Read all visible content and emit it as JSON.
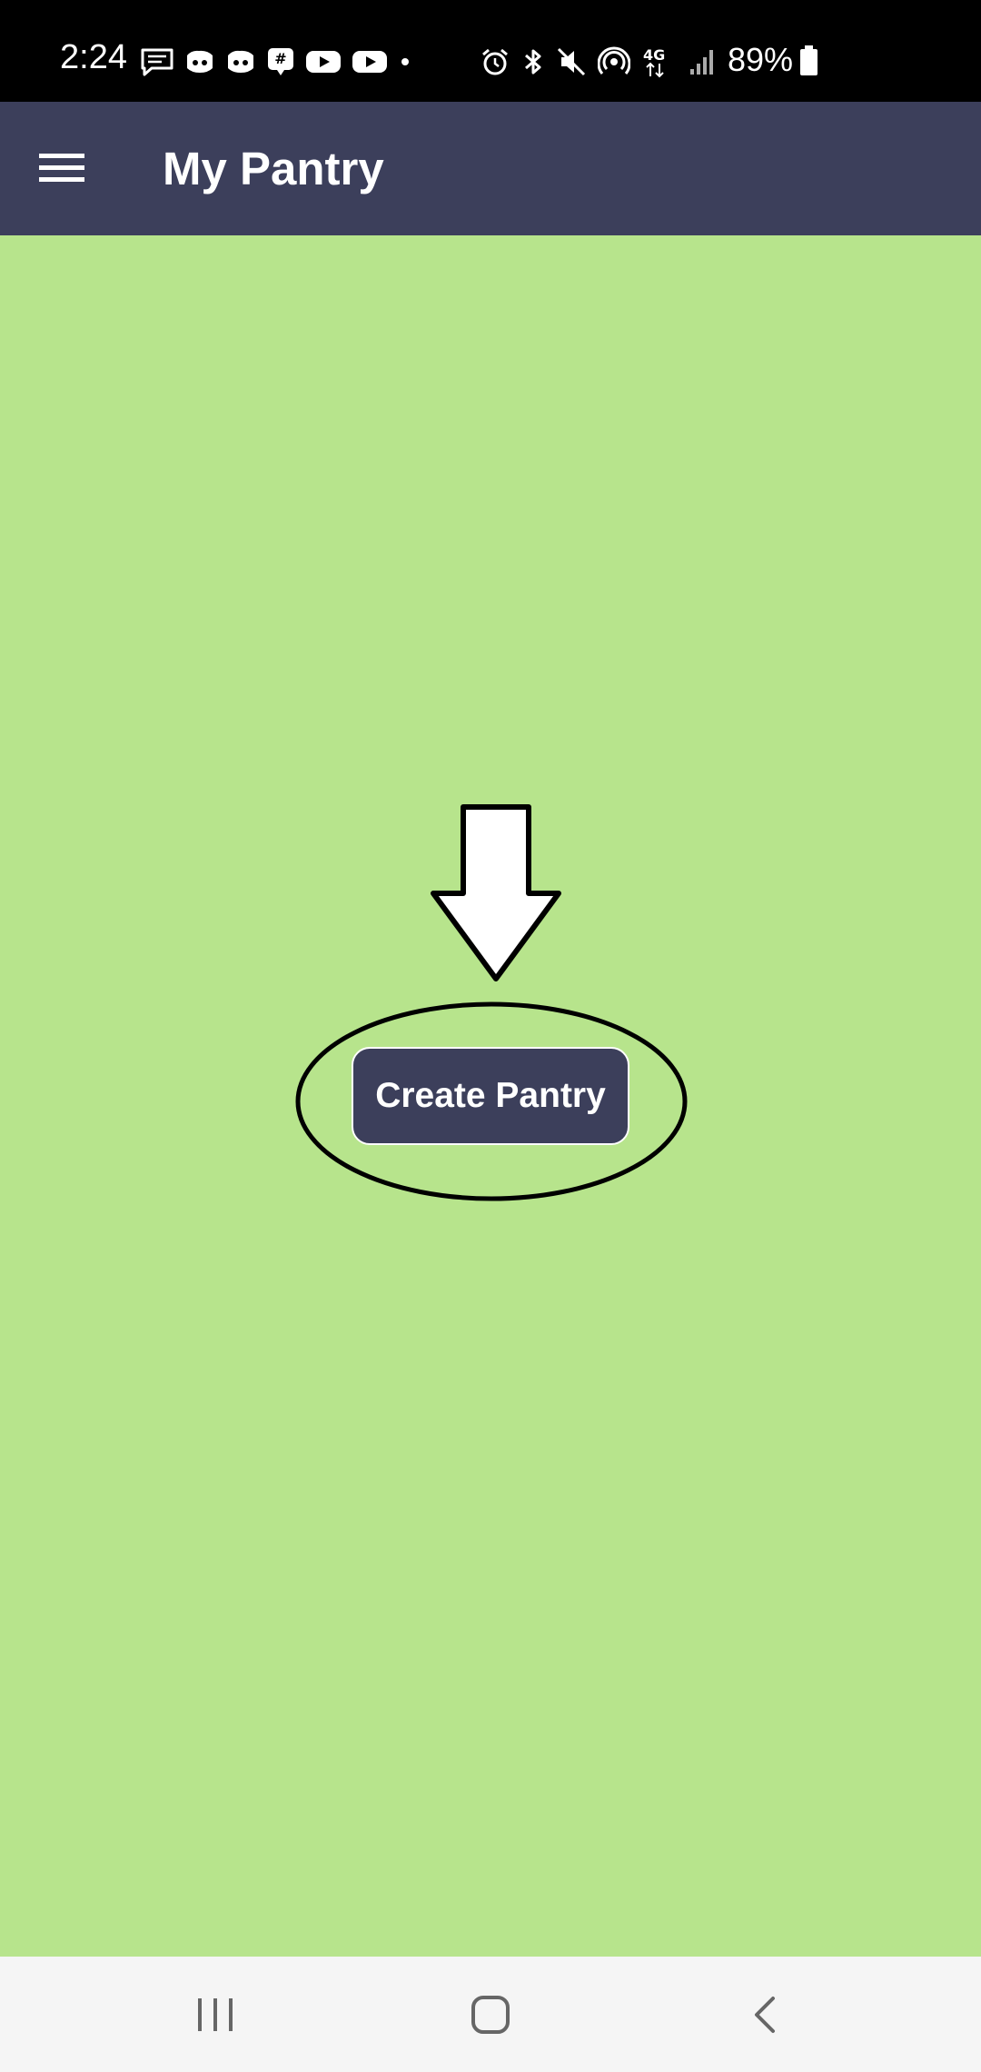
{
  "status_bar": {
    "time": "2:24",
    "battery_percent": "89%",
    "notification_icons": [
      "message-icon",
      "discord-icon",
      "discord-icon",
      "groupme-icon",
      "youtube-icon",
      "youtube-icon",
      "more-notifications-dot-icon"
    ],
    "system_icons": [
      "alarm-icon",
      "bluetooth-icon",
      "mute-icon",
      "hotspot-icon",
      "4g-lte-icon",
      "signal-icon",
      "battery-icon"
    ]
  },
  "app_bar": {
    "title": "My Pantry",
    "menu_icon": "hamburger-menu-icon",
    "background_color": "#3c3f5b"
  },
  "main": {
    "background_color": "#b7e48c",
    "create_button_label": "Create Pantry",
    "annotations": [
      "down-arrow",
      "circle-highlight"
    ]
  },
  "nav_bar": {
    "buttons": [
      "recents-icon",
      "home-icon",
      "back-icon"
    ]
  }
}
